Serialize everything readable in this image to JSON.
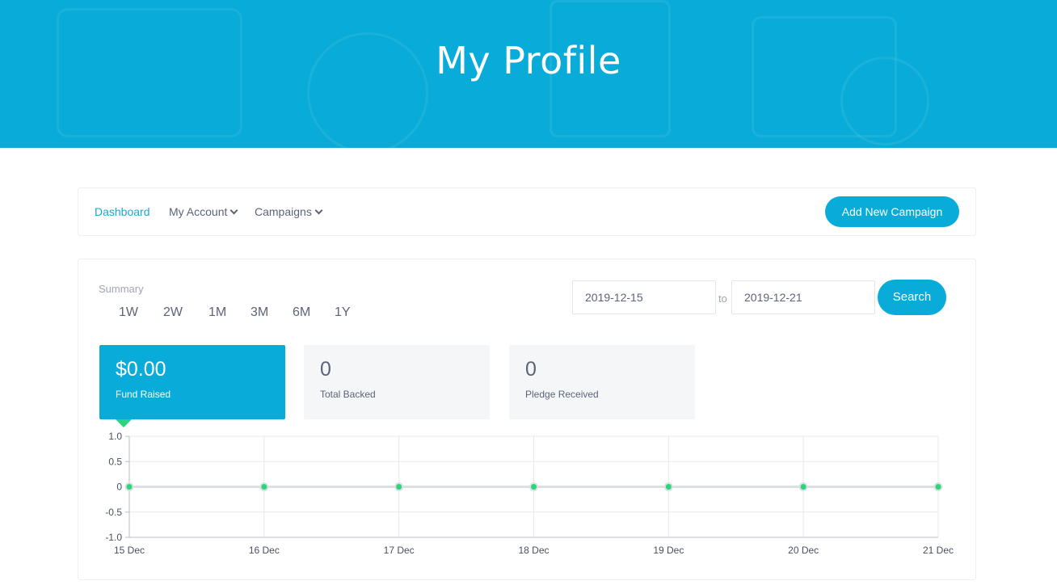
{
  "header": {
    "title": "My Profile"
  },
  "nav": {
    "dashboard": "Dashboard",
    "my_account": "My Account",
    "campaigns": "Campaigns",
    "add_campaign": "Add New Campaign"
  },
  "summary": {
    "label": "Summary",
    "ranges": [
      "1W",
      "2W",
      "1M",
      "3M",
      "6M",
      "1Y"
    ],
    "date_from": "2019-12-15",
    "date_to": "2019-12-21",
    "to_label": "to",
    "search_label": "Search"
  },
  "stats": [
    {
      "value": "$0.00",
      "label": "Fund Raised",
      "active": true
    },
    {
      "value": "0",
      "label": "Total Backed",
      "active": false
    },
    {
      "value": "0",
      "label": "Pledge Received",
      "active": false
    }
  ],
  "colors": {
    "accent": "#09acd8",
    "point": "#2bd67b"
  },
  "chart_data": {
    "type": "line",
    "categories": [
      "15 Dec",
      "16 Dec",
      "17 Dec",
      "18 Dec",
      "19 Dec",
      "20 Dec",
      "21 Dec"
    ],
    "series": [
      {
        "values": [
          0,
          0,
          0,
          0,
          0,
          0,
          0
        ]
      }
    ],
    "ylim": [
      -1.0,
      1.0
    ],
    "yticks": [
      "1.0",
      "0.5",
      "0",
      "-0.5",
      "-1.0"
    ],
    "grid": true,
    "title": "",
    "xlabel": "",
    "ylabel": ""
  }
}
